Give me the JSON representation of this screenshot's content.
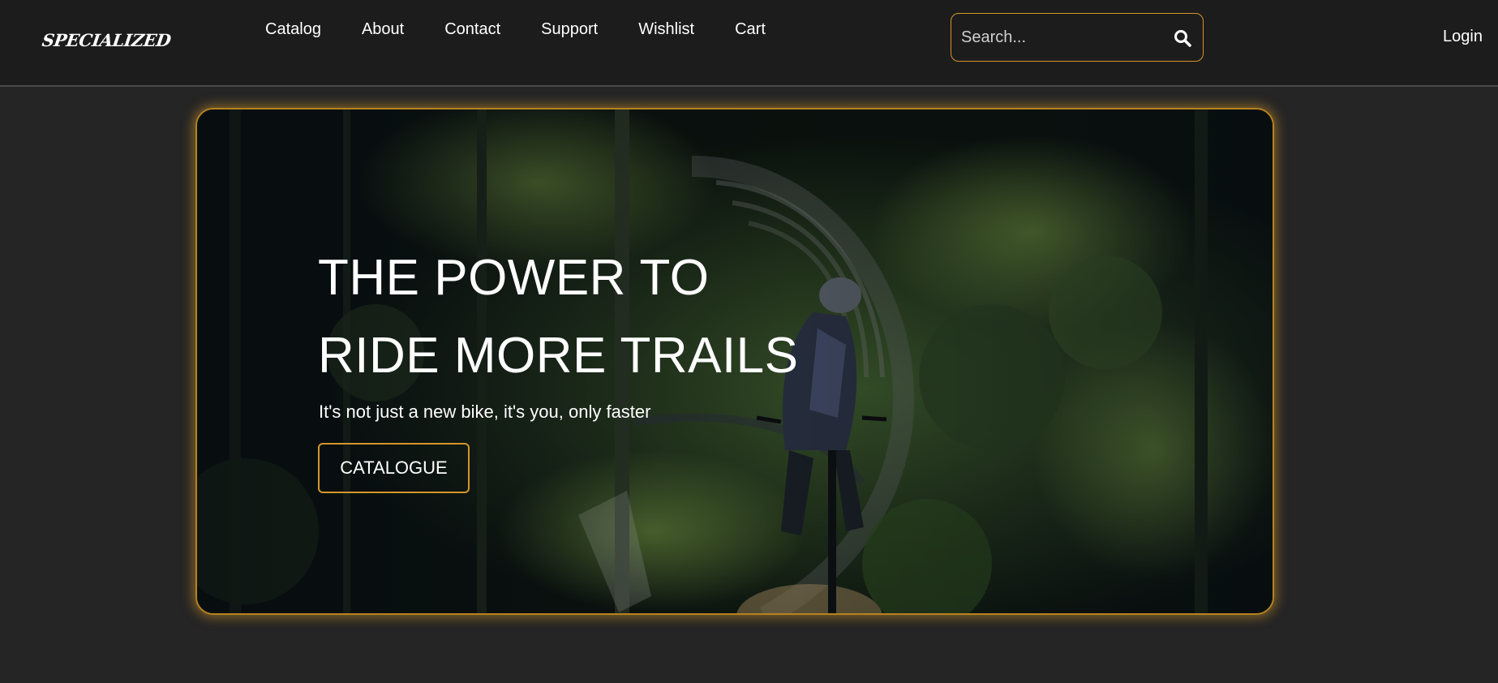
{
  "brand": {
    "logo_text": "SPECIALIZED",
    "logo_icon": "specialized-s-icon",
    "accent_color": "#d4962a",
    "logo_color": "#e0202a"
  },
  "nav": {
    "items": [
      {
        "label": "Catalog"
      },
      {
        "label": "About"
      },
      {
        "label": "Contact"
      },
      {
        "label": "Support"
      },
      {
        "label": "Wishlist"
      },
      {
        "label": "Cart"
      }
    ]
  },
  "search": {
    "placeholder": "Search...",
    "value": "",
    "icon": "search-icon"
  },
  "login_label": "Login",
  "hero": {
    "title_line1": "THE POWER TO",
    "title_line2": "RIDE MORE TRAILS",
    "subtitle": "It's not just a new bike, it's you, only faster",
    "button_label": "CATALOGUE",
    "image": "mountain-biker-forest-trail-photo"
  }
}
